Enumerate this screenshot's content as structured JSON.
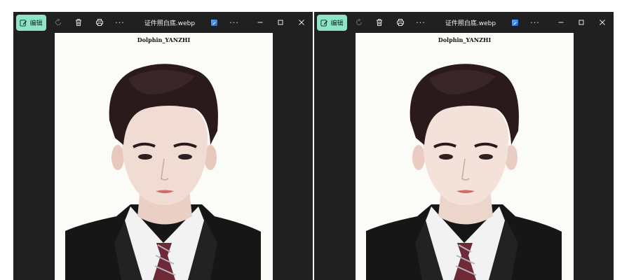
{
  "windows": [
    {
      "toolbar": {
        "edit_label": "编辑",
        "file_title": "证件照白底.webp",
        "more_label": "···"
      },
      "photo": {
        "caption": "Dolphin_YANZHI"
      }
    },
    {
      "toolbar": {
        "edit_label": "编辑",
        "file_title": "证件照白底.webp",
        "more_label": "···"
      },
      "photo": {
        "caption": "Dolphin_YANZHI"
      }
    }
  ],
  "colors": {
    "window_bg": "#202020",
    "edit_button_bg": "#8ee3c8",
    "photo_bg": "#fbfbf8"
  }
}
